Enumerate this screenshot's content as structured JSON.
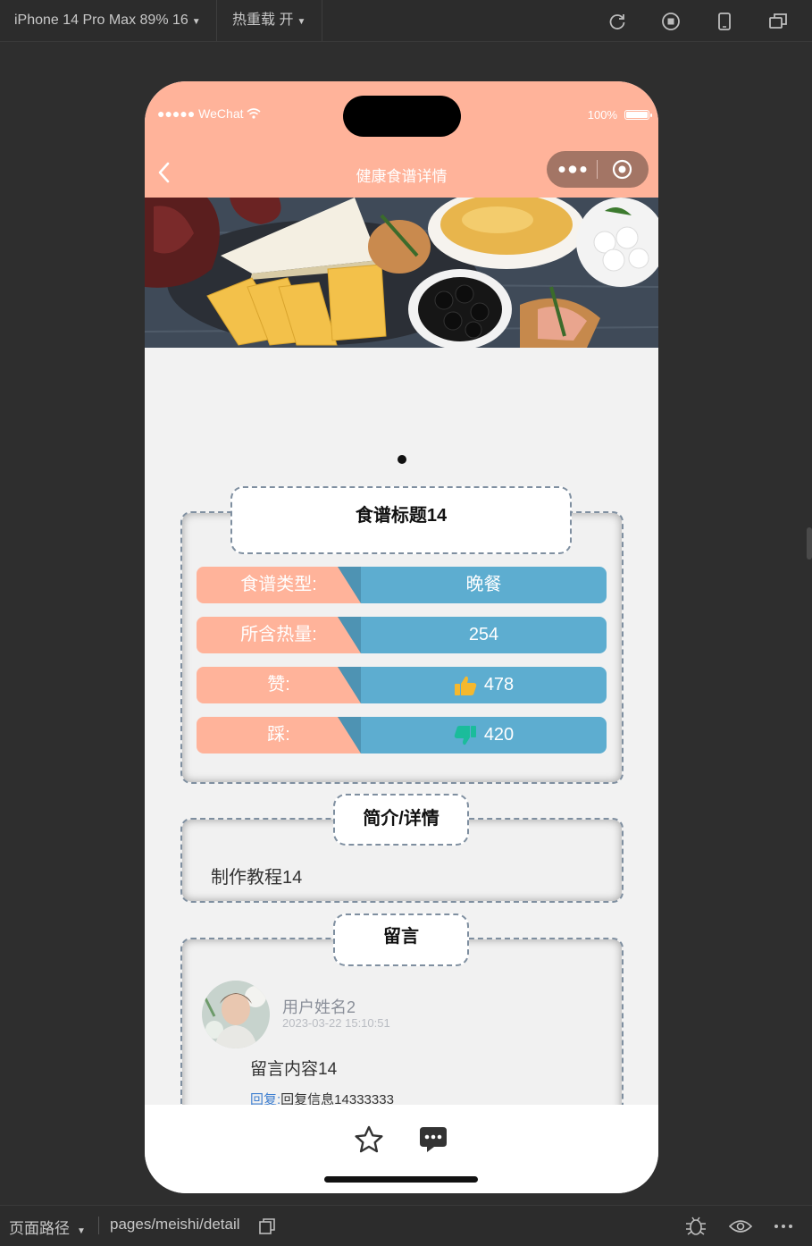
{
  "toolbar": {
    "device": "iPhone 14 Pro Max 89% 16",
    "hot_reload": "热重载 开",
    "icons": [
      "refresh-icon",
      "record-icon",
      "phone-icon",
      "window-icon"
    ]
  },
  "status_bar": {
    "carrier": "●●●●● WeChat",
    "battery": "100%"
  },
  "nav": {
    "title": "健康食谱详情"
  },
  "recipe": {
    "title": "食谱标题14",
    "rows": [
      {
        "label": "食谱类型:",
        "value": "晚餐"
      },
      {
        "label": "所含热量:",
        "value": "254"
      },
      {
        "label": "赞:",
        "value": "478",
        "icon": "thumbs-up-icon"
      },
      {
        "label": "踩:",
        "value": "420",
        "icon": "thumbs-down-icon"
      }
    ]
  },
  "intro": {
    "tag": "简介/详情",
    "content": "制作教程14"
  },
  "comments": {
    "tag": "留言",
    "items": [
      {
        "user": "用户姓名2",
        "time": "2023-03-22 15:10:51",
        "content": "留言内容14",
        "reply_label": "回复:",
        "reply": "回复信息14333333"
      }
    ]
  },
  "footer": {
    "path_label": "页面路径",
    "path": "pages/meishi/detail"
  },
  "colors": {
    "header": "#ffb39a",
    "value_bg": "#5dadd0",
    "like": "#f5b82e",
    "dislike": "#1bbc9b",
    "reply": "#3f7fd0"
  }
}
